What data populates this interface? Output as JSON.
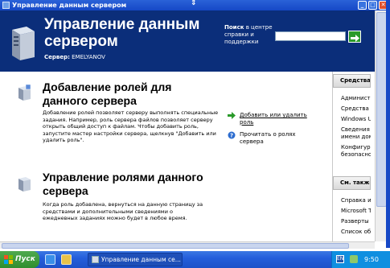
{
  "window": {
    "title": "Управление данным сервером"
  },
  "header": {
    "title": "Управление данным сервером",
    "server_label": "Сервер:",
    "server_name": "EMELYANOV",
    "search_label_bold": "Поиск",
    "search_label_rest": " в центре справки и поддержки",
    "search_value": ""
  },
  "sections": [
    {
      "title": "Добавление ролей для данного сервера",
      "body": "Добавление ролей позволяет серверу выполнять специальные задания. Например, роль сервера файлов позволяет серверу открыть общий доступ к файлам. Чтобы добавить роль, запустите мастер настройки сервера, щелкнув \"Добавить или удалить роль\".",
      "links": [
        {
          "label": "Добавить или удалить роль",
          "icon": "green-arrow-icon"
        },
        {
          "label": "Прочитать о ролях сервера",
          "icon": "help-icon"
        }
      ]
    },
    {
      "title": "Управление ролями данного сервера",
      "body": "Когда роль добавлена, вернуться на данную страницу за средствами и дополнительными сведениями о ежедневных заданиях можно будет в любое время."
    }
  ],
  "right_panel": {
    "tools_header": "Средства",
    "tools_items": [
      "Администр",
      "Средства",
      "Windows U",
      "Сведения",
      "имени дом",
      "Конфигур",
      "безопасно"
    ],
    "see_also_header": "См. также",
    "see_also_items": [
      "Справка и",
      "Microsoft T",
      "Разверты",
      "Список об"
    ]
  },
  "taskbar": {
    "start_label": "Пуск",
    "task_label": "Управление данным се...",
    "clock": "9:50"
  },
  "colors": {
    "header_bg": "#0b2e7a",
    "titlebar": "#1648c6",
    "taskbar": "#245edb",
    "start": "#2f8e2f"
  }
}
